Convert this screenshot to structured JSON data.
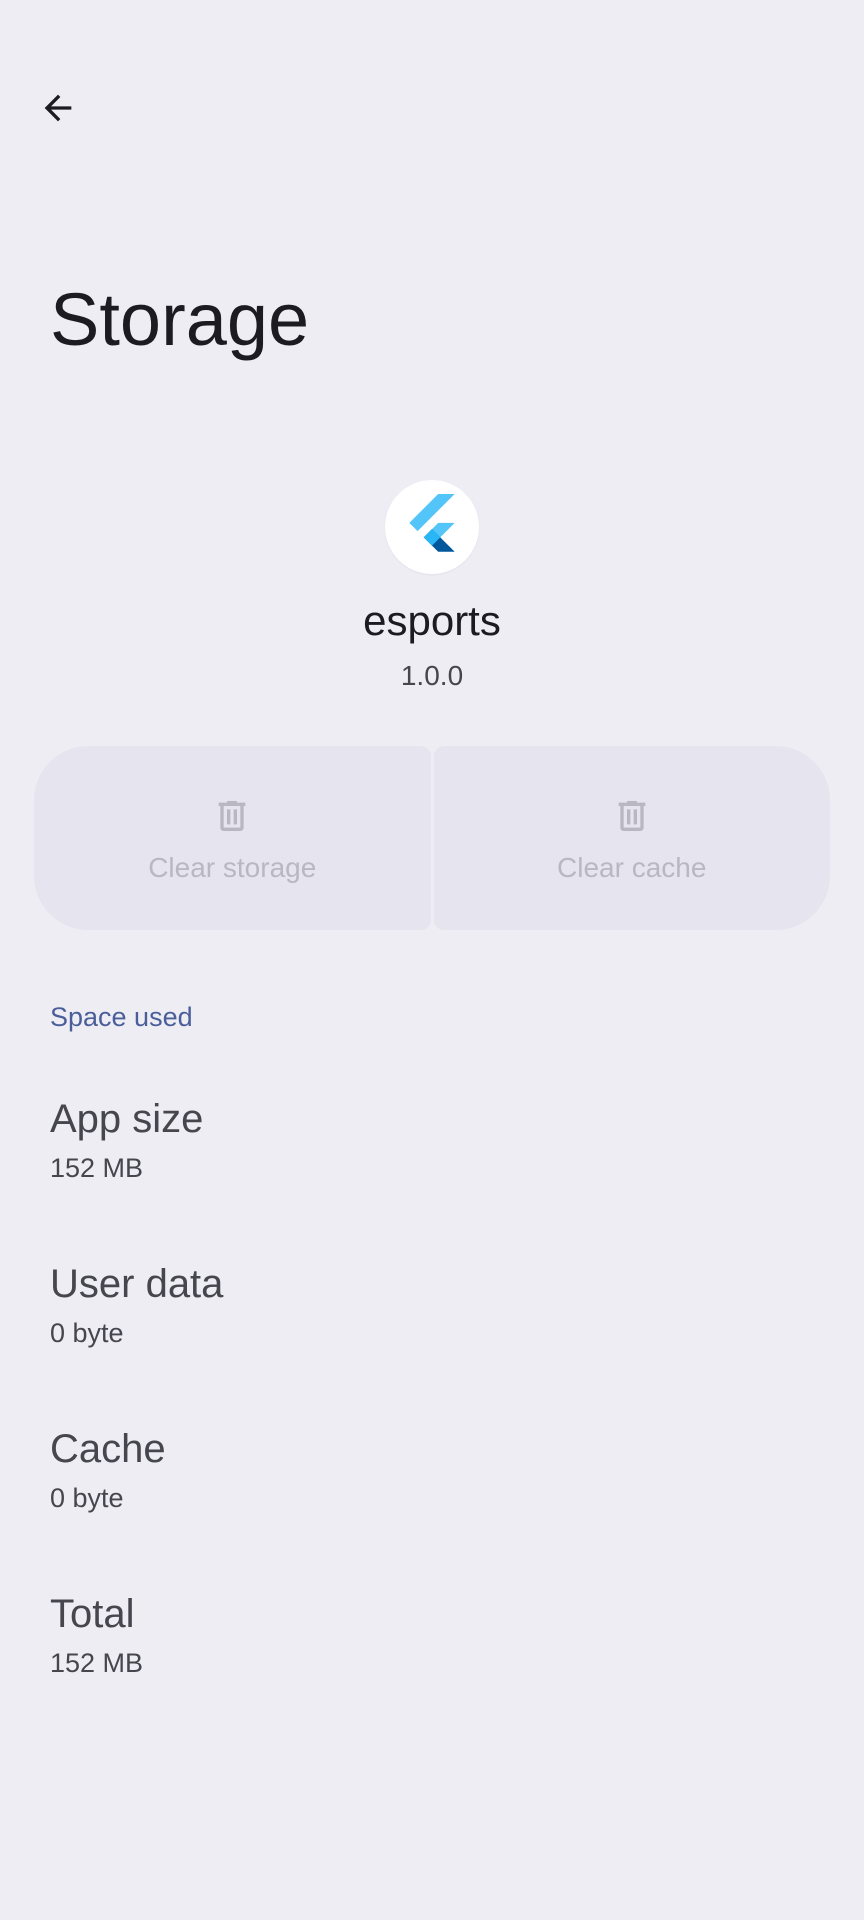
{
  "page": {
    "title": "Storage"
  },
  "app": {
    "name": "esports",
    "version": "1.0.0",
    "icon": "flutter-logo"
  },
  "actions": {
    "clear_storage": {
      "label": "Clear storage",
      "icon": "trash-icon",
      "enabled": false
    },
    "clear_cache": {
      "label": "Clear cache",
      "icon": "trash-icon",
      "enabled": false
    }
  },
  "space_used": {
    "header": "Space used",
    "items": [
      {
        "label": "App size",
        "value": "152 MB"
      },
      {
        "label": "User data",
        "value": "0 byte"
      },
      {
        "label": "Cache",
        "value": "0 byte"
      },
      {
        "label": "Total",
        "value": "152 MB"
      }
    ]
  },
  "colors": {
    "background": "#efedf4",
    "accent": "#4a5f9a",
    "button_bg": "#e6e4ee",
    "disabled_text": "#b9b8c2"
  }
}
